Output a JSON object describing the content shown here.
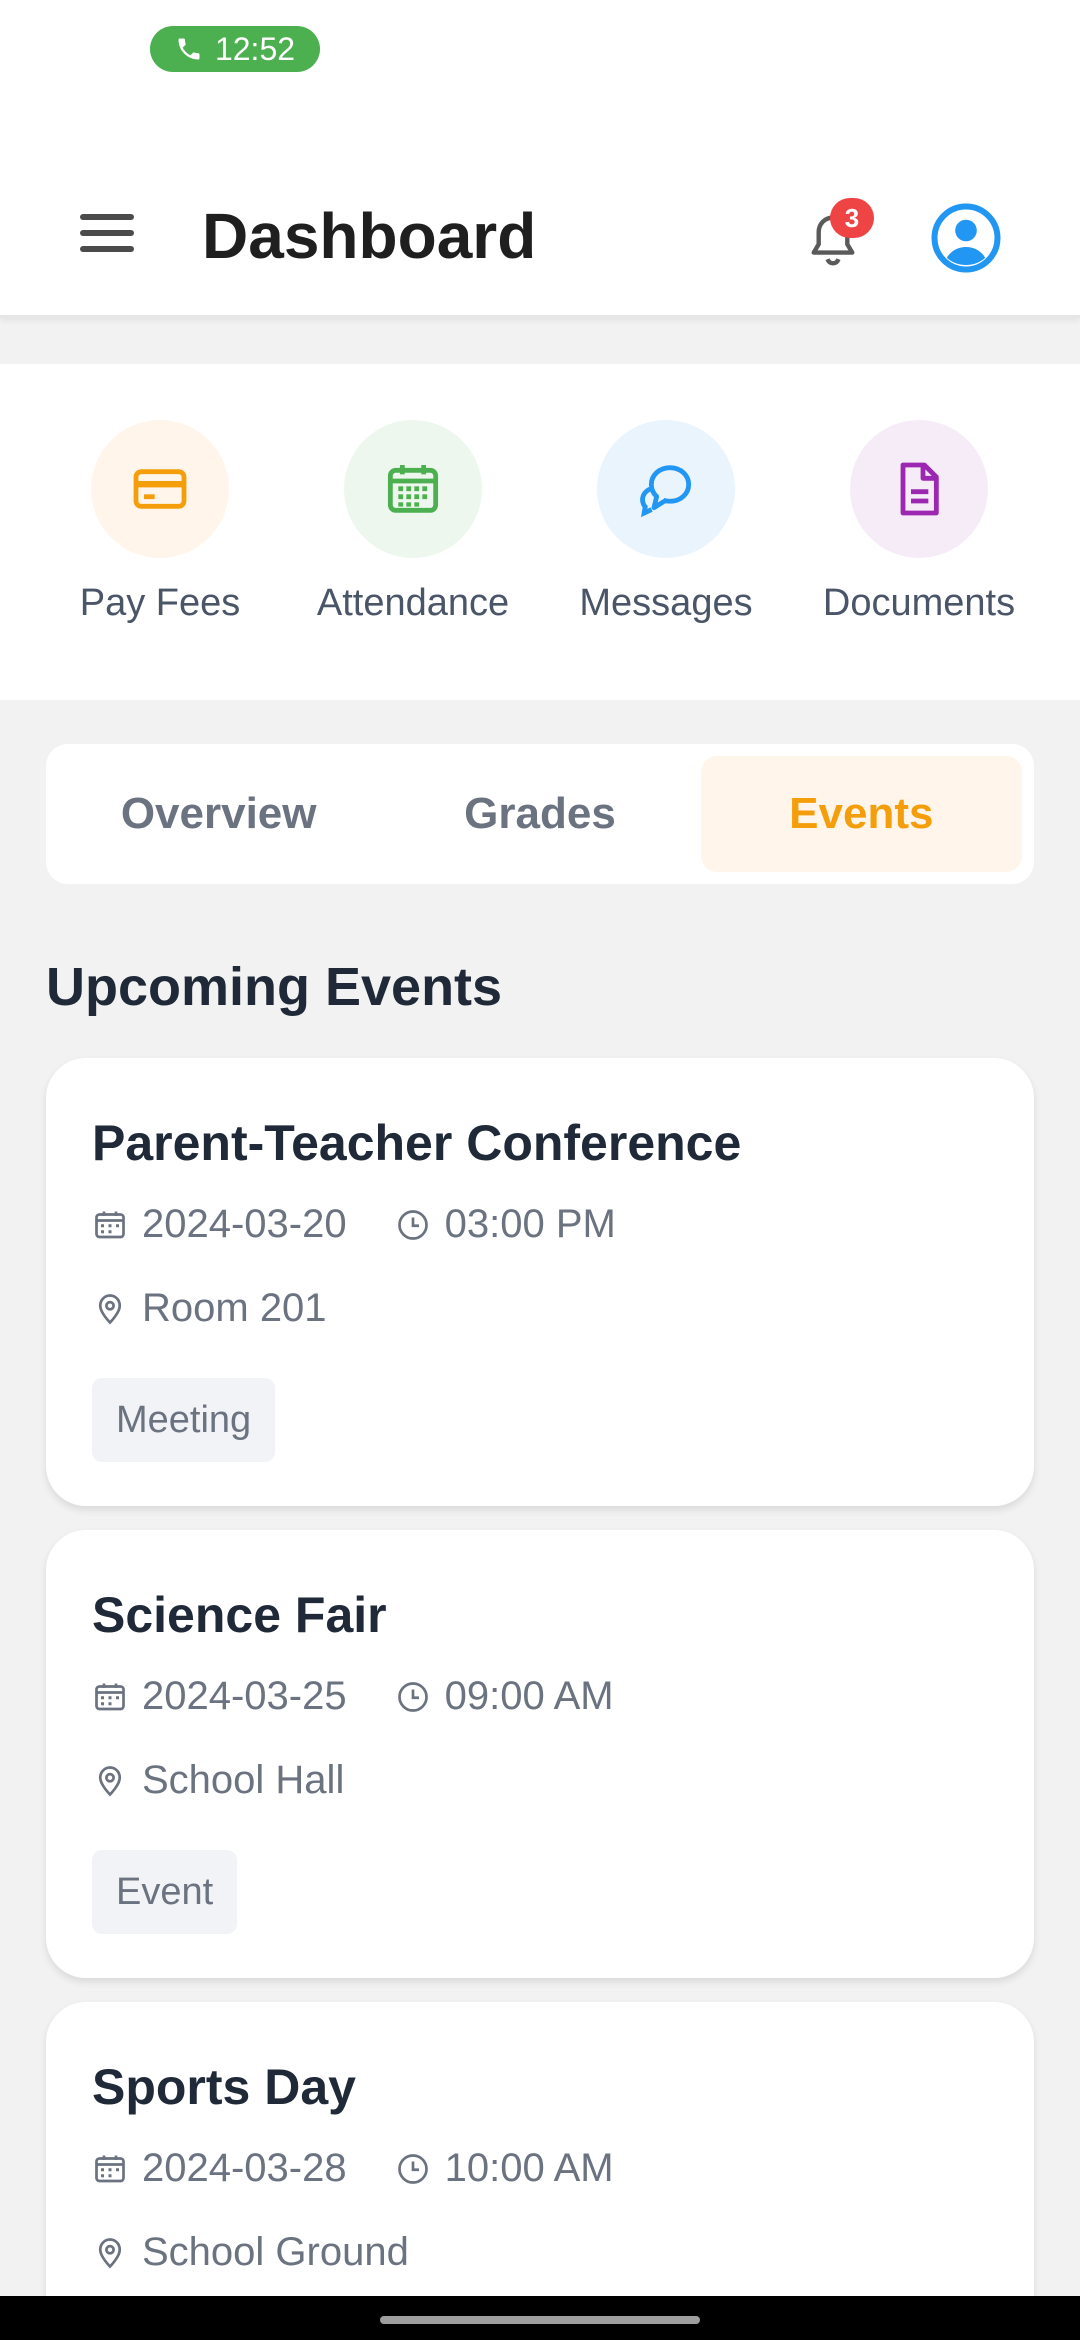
{
  "status_bar": {
    "call_time": "12:52"
  },
  "app_bar": {
    "title": "Dashboard",
    "notification_count": "3"
  },
  "quick_actions": [
    {
      "label": "Pay Fees",
      "icon": "credit-card-icon",
      "color": "#f59e0b",
      "bg": "#fff5ea"
    },
    {
      "label": "Attendance",
      "icon": "calendar-icon",
      "color": "#4caf50",
      "bg": "#eef7ee"
    },
    {
      "label": "Messages",
      "icon": "chat-icon",
      "color": "#2196f3",
      "bg": "#eaf4fd"
    },
    {
      "label": "Documents",
      "icon": "document-icon",
      "color": "#9c27b0",
      "bg": "#f6ecf8"
    }
  ],
  "tabs": [
    {
      "label": "Overview",
      "active": false
    },
    {
      "label": "Grades",
      "active": false
    },
    {
      "label": "Events",
      "active": true
    }
  ],
  "section_title": "Upcoming Events",
  "events": [
    {
      "title": "Parent-Teacher Conference",
      "date": "2024-03-20",
      "time": "03:00 PM",
      "location": "Room 201",
      "tag": "Meeting"
    },
    {
      "title": "Science Fair",
      "date": "2024-03-25",
      "time": "09:00 AM",
      "location": "School Hall",
      "tag": "Event"
    },
    {
      "title": "Sports Day",
      "date": "2024-03-28",
      "time": "10:00 AM",
      "location": "School Ground",
      "tag": ""
    }
  ],
  "colors": {
    "accent": "#f59e0b",
    "badge": "#ef4444",
    "profile": "#2196f3"
  }
}
